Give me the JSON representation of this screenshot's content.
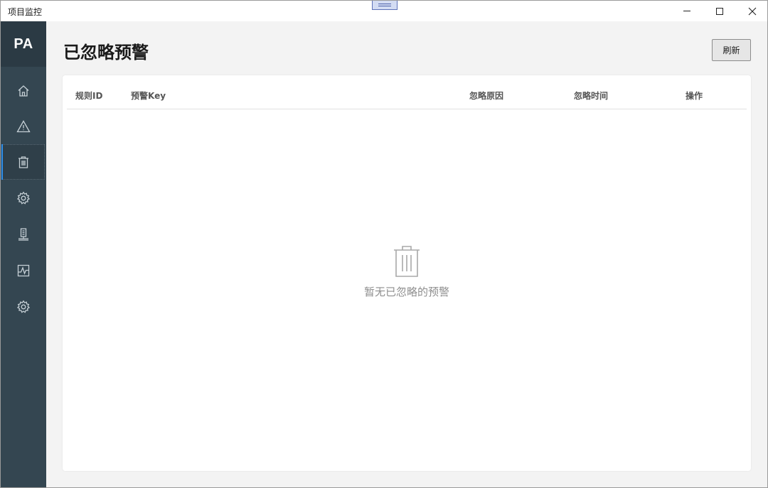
{
  "window": {
    "title": "项目监控"
  },
  "sidebar": {
    "logo": "PA",
    "items": [
      {
        "icon": "home-icon",
        "active": false
      },
      {
        "icon": "warning-icon",
        "active": false
      },
      {
        "icon": "trash-icon",
        "active": true
      },
      {
        "icon": "gear-icon",
        "active": false
      },
      {
        "icon": "server-icon",
        "active": false
      },
      {
        "icon": "chart-icon",
        "active": false
      },
      {
        "icon": "gear-icon",
        "active": false
      }
    ]
  },
  "main": {
    "title": "已忽略预警",
    "refresh_label": "刷新",
    "table": {
      "columns": [
        "规则ID",
        "预警Key",
        "忽略原因",
        "忽略时间",
        "操作"
      ],
      "rows": []
    },
    "empty_text": "暂无已忽略的预警"
  },
  "colors": {
    "sidebar_bg": "#344651",
    "logo_bg": "#2b3a44",
    "active_accent": "#2e8ee8"
  }
}
